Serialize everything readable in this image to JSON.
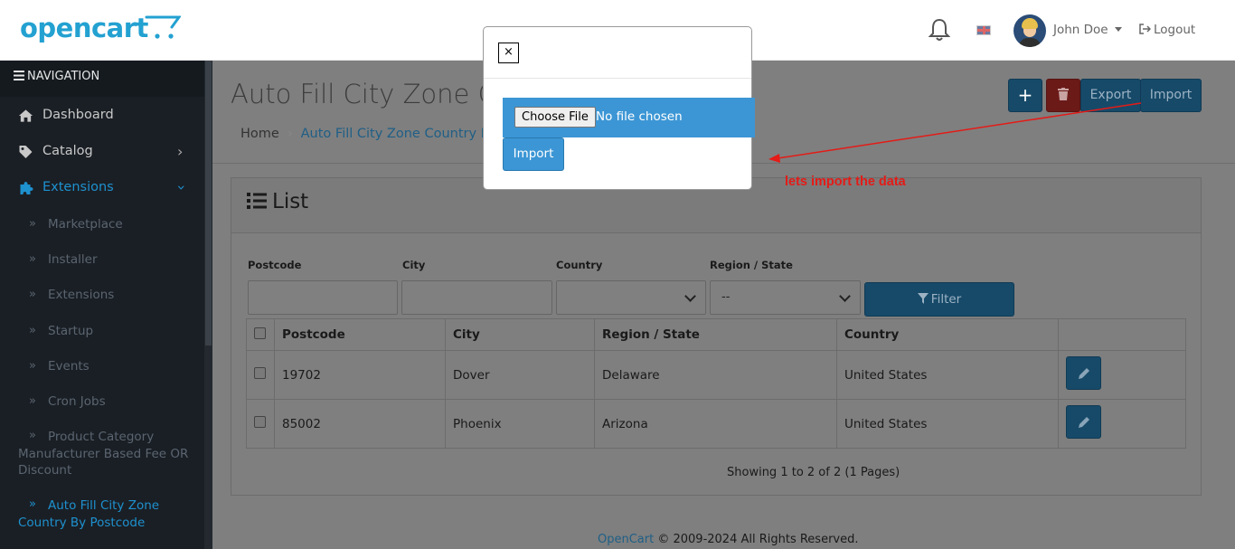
{
  "header": {
    "logo_text": "opencart",
    "user_name": "John Doe",
    "logout_label": "Logout"
  },
  "sidebar": {
    "nav_header": "NAVIGATION",
    "items": [
      {
        "label": "Dashboard",
        "icon": "home-icon"
      },
      {
        "label": "Catalog",
        "icon": "tag-icon"
      },
      {
        "label": "Extensions",
        "icon": "puzzle-icon"
      }
    ],
    "sub_items": [
      {
        "label": "Marketplace"
      },
      {
        "label": "Installer"
      },
      {
        "label": "Extensions"
      },
      {
        "label": "Startup"
      },
      {
        "label": "Events"
      },
      {
        "label": "Cron Jobs"
      },
      {
        "label": "Product Category Manufacturer Based Fee OR Discount"
      },
      {
        "label": "Auto Fill City Zone Country By Postcode"
      }
    ]
  },
  "page": {
    "title": "Auto Fill City Zone Co",
    "breadcrumb_home": "Home",
    "breadcrumb_current": "Auto Fill City Zone Country By",
    "toolbar": {
      "add_label": "+",
      "export_label": "Export",
      "import_label": "Import"
    }
  },
  "panel": {
    "title": "List",
    "filters": {
      "postcode_label": "Postcode",
      "city_label": "City",
      "country_label": "Country",
      "region_label": "Region / State",
      "region_value": "--",
      "filter_label": "Filter"
    },
    "table": {
      "headers": [
        "Postcode",
        "City",
        "Region / State",
        "Country"
      ],
      "rows": [
        {
          "postcode": "19702",
          "city": "Dover",
          "region": "Delaware",
          "country": "United States"
        },
        {
          "postcode": "85002",
          "city": "Phoenix",
          "region": "Arizona",
          "country": "United States"
        }
      ]
    },
    "showing": "Showing 1 to 2 of 2 (1 Pages)"
  },
  "footer": {
    "link": "OpenCart",
    "text": " © 2009-2024 All Rights Reserved."
  },
  "modal": {
    "close_label": "×",
    "choose_file_label": "Choose File",
    "no_file_label": "No file chosen",
    "import_label": "Import"
  },
  "annotation": {
    "text": "lets import the data",
    "color": "#e41b17"
  }
}
